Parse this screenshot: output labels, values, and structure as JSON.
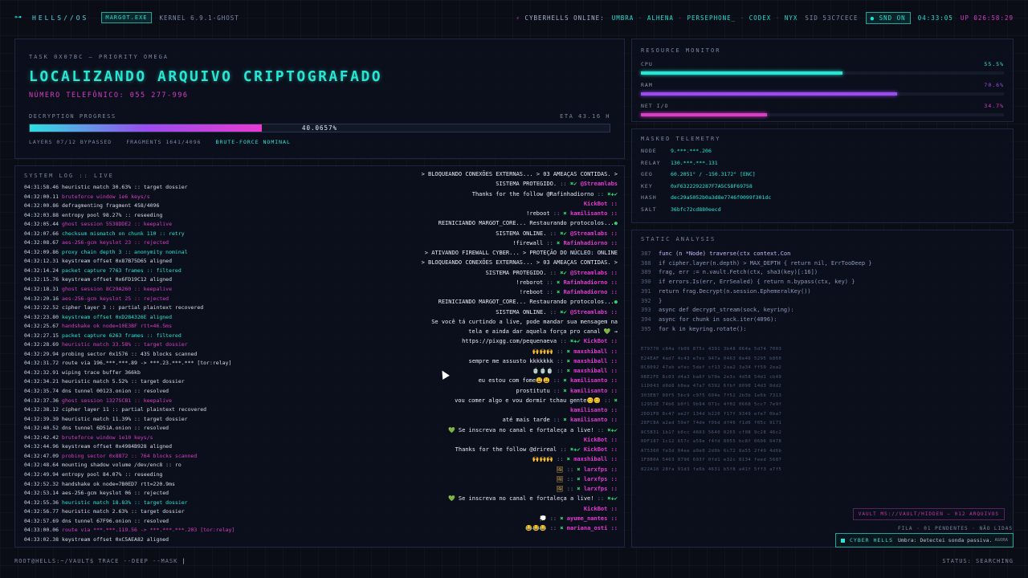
{
  "topbar": {
    "brand": "HELLS//OS",
    "exe": "MARGOT.EXE",
    "kernel": "KERNEL 6.9.1-GHOST",
    "online_label": "CYBERHELLS ONLINE:",
    "users": [
      "UMBRA",
      "ALHENA",
      "PERSEPHONE_",
      "CODEX",
      "NYX"
    ],
    "sid": "SID 53C7CECE",
    "snd": "SND ON",
    "time": "04:33:05",
    "uptime": "UP 026:58:29"
  },
  "task": {
    "id": "TASK 0X07BC — PRIORITY OMEGA",
    "headline": "LOCALIZANDO ARQUIVO CRIPTOGRAFADO",
    "phone": "NÚMERO TELEFÔNICO: 055 277-996",
    "progress_label": "DECRYPTION PROGRESS",
    "eta": "ETA 43.16 H",
    "progress": 0.400657,
    "progress_text": "40.0657%",
    "layers": "LAYERS 07/12 BYPASSED",
    "fragments": "FRAGMENTS 1641/4096",
    "mode": "BRUTE-FORCE NOMINAL"
  },
  "syslog": {
    "title": "SYSTEM LOG :: LIVE",
    "lines": [
      {
        "ts": "04:31:58.46",
        "text": "heuristic match 30.63% :: target dossier",
        "c": "white"
      },
      {
        "ts": "04:32:00.11",
        "text": "bruteforce window 1e6 keys/s",
        "c": "mag"
      },
      {
        "ts": "04:32:00.86",
        "text": "defragmenting fragment 458/4096",
        "c": "white"
      },
      {
        "ts": "04:32:03.88",
        "text": "entropy pool 98.27% :: reseeding",
        "c": "white"
      },
      {
        "ts": "04:32:05.44",
        "text": "ghost session 5538DDE2 :: keepalive",
        "c": "mag"
      },
      {
        "ts": "04:32:07.66",
        "text": "checksum mismatch on chunk 110 :: retry",
        "c": "cyan"
      },
      {
        "ts": "04:32:08.67",
        "text": "aes-256-gcm keyslot 23 :: rejected",
        "c": "mag"
      },
      {
        "ts": "04:32:09.86",
        "text": "proxy chain depth 3 :: anonymity nominal",
        "c": "cyan"
      },
      {
        "ts": "04:32:12.31",
        "text": "keystream offset 0x87B75D65 aligned",
        "c": "white"
      },
      {
        "ts": "04:32:14.24",
        "text": "packet capture 7763 frames :: filtered",
        "c": "cyan"
      },
      {
        "ts": "04:32:15.76",
        "text": "keystream offset 0x6FD19C12 aligned",
        "c": "white"
      },
      {
        "ts": "04:32:18.31",
        "text": "ghost session 8C29A260 :: keepalive",
        "c": "mag"
      },
      {
        "ts": "04:32:20.16",
        "text": "aes-256-gcm keyslot 25 :: rejected",
        "c": "mag"
      },
      {
        "ts": "04:32:22.52",
        "text": "cipher layer 3 :: partial plaintext recovered",
        "c": "white"
      },
      {
        "ts": "04:32:23.80",
        "text": "keystream offset 0xD284326E aligned",
        "c": "cyan"
      },
      {
        "ts": "04:32:25.67",
        "text": "handshake ok node=10E3BF rtt=46.5ms",
        "c": "mag"
      },
      {
        "ts": "04:32:27.15",
        "text": "packet capture 6263 frames :: filtered",
        "c": "cyan"
      },
      {
        "ts": "04:32:28.69",
        "text": "heuristic match 33.58% :: target dossier",
        "c": "mag"
      },
      {
        "ts": "04:32:29.94",
        "text": "probing sector 0x1576 :: 435 blocks scanned",
        "c": "white"
      },
      {
        "ts": "04:32:31.72",
        "text": "route via 196.***.***.89 -> ***.23.***.*** [tor:relay]",
        "c": "white"
      },
      {
        "ts": "04:32:32.91",
        "text": "wiping trace buffer 366kb",
        "c": "white"
      },
      {
        "ts": "04:32:34.21",
        "text": "heuristic match 5.52% :: target dossier",
        "c": "white"
      },
      {
        "ts": "04:32:35.74",
        "text": "dns tunnel 00123.onion :: resolved",
        "c": "white"
      },
      {
        "ts": "04:32:37.36",
        "text": "ghost session 1327SCB1 :: keepalive",
        "c": "mag"
      },
      {
        "ts": "04:32:38.12",
        "text": "cipher layer 11 :: partial plaintext recovered",
        "c": "white"
      },
      {
        "ts": "04:32:39.39",
        "text": "heuristic match 11.39% :: target dossier",
        "c": "white"
      },
      {
        "ts": "04:32:40.52",
        "text": "dns tunnel 6D51A.onion :: resolved",
        "c": "white"
      },
      {
        "ts": "04:32:42.42",
        "text": "bruteforce window 1e10 keys/s",
        "c": "mag"
      },
      {
        "ts": "04:32:44.96",
        "text": "keystream offset 0x4984B928 aligned",
        "c": "white"
      },
      {
        "ts": "04:32:47.09",
        "text": "probing sector 0x8872 :: 764 blocks scanned",
        "c": "mag"
      },
      {
        "ts": "04:32:48.64",
        "text": "mounting shadow volume /dev/enc8 :: ro",
        "c": "white"
      },
      {
        "ts": "04:32:49.94",
        "text": "entropy pool 84.07% :: reseeding",
        "c": "white"
      },
      {
        "ts": "04:32:52.32",
        "text": "handshake ok node=7B0ED7 rtt=220.9ms",
        "c": "white"
      },
      {
        "ts": "04:32:53.14",
        "text": "aes-256-gcm keyslot 06 :: rejected",
        "c": "white"
      },
      {
        "ts": "04:32:55.36",
        "text": "heuristic match 18.83% :: target dossier",
        "c": "cyan"
      },
      {
        "ts": "04:32:56.77",
        "text": "heuristic match 2.63% :: target dossier",
        "c": "white"
      },
      {
        "ts": "04:32:57.69",
        "text": "dns tunnel 67F96.onion :: resolved",
        "c": "white"
      },
      {
        "ts": "04:33:00.06",
        "text": "route via ***.***.119.56 -> ***.***.***.203 [tor:relay]",
        "c": "mag"
      },
      {
        "ts": "04:33:02.38",
        "text": "keystream offset 0xC5AEA82 aligned",
        "c": "white"
      }
    ]
  },
  "chat": [
    {
      "msg": "> BLOQUEANDO CONEXÕES EXTERNAS... > 03 AMEAÇAS CONTIDAS. >",
      "faded": true
    },
    {
      "msg": "SISTEMA PROTEGIDO.",
      "sep": "::",
      "badge": "✖✔",
      "author": "@Streamlabs",
      "faded": true
    },
    {
      "msg": "Thanks for the follow @Rafinhadiorno",
      "sep": "::",
      "badge": "✖✚✔",
      "author": ""
    },
    {
      "msg": "",
      "sep": "",
      "badge": "",
      "author": "KickBot ::"
    },
    {
      "msg": "!reboot",
      "sep": "::",
      "badge": "✖",
      "author": "kamilisanto ::"
    },
    {
      "msg": "REINICIANDO MARGOT_CORE... Restaurando protocolos...",
      "sep": "",
      "badge": "●",
      "author": ""
    },
    {
      "msg": "SISTEMA ONLINE.",
      "sep": "::",
      "badge": "✖✔",
      "author": "@Streamlabs ::"
    },
    {
      "msg": "!firewall",
      "sep": "::",
      "badge": "✖",
      "author": "Rafinhadiorno ::"
    },
    {
      "msg": "> ATIVANDO FIREWALL CYBER... > PROTEÇÃO DO NÚCLEO: ONLINE",
      "sep": "",
      "badge": "",
      "author": ""
    },
    {
      "msg": "> BLOQUEANDO CONEXÕES EXTERNAS... > 03 AMEAÇAS CONTIDAS. >",
      "sep": "",
      "badge": "",
      "author": ""
    },
    {
      "msg": "SISTEMA PROTEGIDO.",
      "sep": "::",
      "badge": "✖✔",
      "author": "@Streamlabs ::"
    },
    {
      "msg": "!reborot",
      "sep": "::",
      "badge": "✖",
      "author": "Rafinhadiorno ::"
    },
    {
      "msg": "!reboot",
      "sep": "::",
      "badge": "✖",
      "author": "Rafinhadiorno ::"
    },
    {
      "msg": "REINICIANDO MARGOT_CORE... Restaurando protocolos...",
      "sep": "",
      "badge": "●",
      "author": ""
    },
    {
      "msg": "SISTEMA ONLINE.",
      "sep": "::",
      "badge": "✖✔",
      "author": "@Streamlabs ::"
    },
    {
      "msg": "Se você tá curtindo a live, pode mandar sua mensagem na",
      "sep": "",
      "badge": "",
      "author": ""
    },
    {
      "msg": "tela e ainda dar aquela força pro canal 💚 →",
      "sep": "",
      "badge": "",
      "author": ""
    },
    {
      "msg": "https://pixgg.com/pequenaeva",
      "sep": "::",
      "badge": "✖✚✔",
      "author": "KickBot ::"
    },
    {
      "msg": "",
      "emo": "🙌🙌🙌",
      "sep": "::",
      "badge": "✖",
      "author": "maxshiball ::"
    },
    {
      "msg": "sempre me assusto kkkkkkk",
      "sep": "::",
      "badge": "✖",
      "author": "maxshiball ::"
    },
    {
      "msg": "",
      "emo": "🍵🍵🍵",
      "sep": "::",
      "badge": "✖",
      "author": "maxshiball ::"
    },
    {
      "msg": "eu estou com fome",
      "emo": "😩😩",
      "sep": "::",
      "badge": "✖",
      "author": "kamilisanto ::"
    },
    {
      "msg": "prostitutu",
      "sep": "::",
      "badge": "✖",
      "author": "kamilisanto ::"
    },
    {
      "msg": "vou comer algo e vou dormir tchau gente",
      "emo": "😊😊",
      "sep": "::",
      "badge": "✖",
      "author": ""
    },
    {
      "msg": "",
      "sep": "",
      "badge": "",
      "author": "kamilisanto ::"
    },
    {
      "msg": "até mais tarde",
      "sep": "::",
      "badge": "✖",
      "author": "kamilisanto ::"
    },
    {
      "msg": "💚 Se inscreva no canal e fortaleça a live!",
      "sep": "::",
      "badge": "✖✚✔",
      "author": ""
    },
    {
      "msg": "",
      "sep": "",
      "badge": "",
      "author": "KickBot ::"
    },
    {
      "msg": "Thanks for the follow @drireal",
      "sep": "::",
      "badge": "✖✚✔",
      "author": "KickBot ::"
    },
    {
      "msg": "",
      "emo": "🙌🙌🙌",
      "sep": "::",
      "badge": "✖",
      "author": "maxshiball ::"
    },
    {
      "msg": "",
      "emo": "🖼",
      "sep": "::",
      "badge": "✖",
      "author": "larxfps ::"
    },
    {
      "msg": "",
      "emo": "🖼",
      "sep": "::",
      "badge": "✖",
      "author": "larxfps ::"
    },
    {
      "msg": "",
      "emo": "🖼",
      "sep": "::",
      "badge": "✖",
      "author": "larxfps ::"
    },
    {
      "msg": "💚 Se inscreva no canal e fortaleça a live!",
      "sep": "::",
      "badge": "✖✚✔",
      "author": ""
    },
    {
      "msg": "",
      "sep": "",
      "badge": "",
      "author": "KickBot ::"
    },
    {
      "msg": "",
      "emo": "💭",
      "sep": "::",
      "badge": "✖",
      "author": "ayume_nantes ::"
    },
    {
      "msg": "",
      "emo": "😂😂😂",
      "sep": "::",
      "badge": "✖",
      "author": "mariana_osti ::"
    }
  ],
  "resources": {
    "title": "RESOURCE MONITOR",
    "items": [
      {
        "label": "CPU",
        "value": 0.555,
        "text": "55.5%",
        "color": "#28e6d4"
      },
      {
        "label": "RAM",
        "value": 0.706,
        "text": "70.6%",
        "color": "#9a4cf0"
      },
      {
        "label": "NET I/O",
        "value": 0.347,
        "text": "34.7%",
        "color": "#d93cc7"
      }
    ]
  },
  "telemetry": {
    "title": "MASKED TELEMETRY",
    "rows": [
      {
        "k": "NODE",
        "v": "9.***.***.206"
      },
      {
        "k": "RELAY",
        "v": "130.***.***.131"
      },
      {
        "k": "GEO",
        "v": "60.2051° / -150.3172° [ENC]"
      },
      {
        "k": "KEY",
        "v": "0xF6322292287F7A5C58F69758"
      },
      {
        "k": "HASH",
        "v": "dec29a5052b0a3d8e7746f0099f301dc"
      },
      {
        "k": "SALT",
        "v": "36bfc72cd880eecd"
      }
    ]
  },
  "static": {
    "title": "STATIC ANALYSIS",
    "code": [
      {
        "ln": "387",
        "src": "func (n *Node) traverse(ctx context.Con",
        "active": true
      },
      {
        "ln": "388",
        "src": "if cipher.layer(n.depth) > MAX_DEPTH { return nil, ErrTooDeep }"
      },
      {
        "ln": "389",
        "src": "frag, err := n.vault.Fetch(ctx, sha3(key)[:16])"
      },
      {
        "ln": "390",
        "src": "if errors.Is(err, ErrSealed) { return n.bypass(ctx, key) }"
      },
      {
        "ln": "391",
        "src": "return frag.Decrypt(n.session.EphemeralKey())"
      },
      {
        "ln": "392",
        "src": "}"
      },
      {
        "ln": "393",
        "src": "async def decrypt_stream(sock, keyring):"
      },
      {
        "ln": "394",
        "src": "async for chunk in sock.iter(4096):"
      },
      {
        "ln": "395",
        "src": "for k in keyring.rotate():"
      }
    ],
    "hex": [
      "E79770 c04a fb09 875c 4391 3b48 064a 5d74 7003",
      "E24EAF 4ad7 4c43 e7ec 947a 0463 8e46 5295 b860",
      "8C8092 47ab afec 5def cf13 2aa2 3a34 ff59 2ea2",
      "0BE2FE 8c03 d4a3 ba6f b70e 2e3c 4d58 54d1 cb49",
      "11D043 d0d8 b0ea 47a7 6392 6fbf 8090 14d3 0dd2",
      "303EB7 80f5 5bc9 c975 604e 7f52 2b3b 1e6b 7313",
      "12952E 74b6 b0f1 9b94 071c 4f02 0668 5cc7 7e9f",
      "2DD1F8 8c47 ae2f 134d b220 f17f 9349 efe7 0ba7",
      "28FC8A a2ad 59ef 74de f0bd df46 f1d6 f05c 9171",
      "8C5B31 1b17 b0cc 4603 5640 0265 cf08 9c28 46c2",
      "0DF187 1c12 657c a59e f4fd 8055 bc8f 0606 0478",
      "A75360 fe3d 04ee a0e0 2d0b 6c72 8a55 2f49 4d6b",
      "1F8B0A 5463 8796 693f 0fd1 e32c 8134 feed 5687",
      "822A16 28fa 91d3 fe6b 4631 b5f8 a41f 5ff3 a7f5"
    ],
    "vault": "VAULT MS://VAULT/HIDDEN — 012 ARQUIVOS",
    "fila": "FILA · 01 PENDENTES · NÃO LIDAS"
  },
  "notification": {
    "name": "CYBER HELLS",
    "text": "Umbra: Detectei sonda passiva.",
    "now": "AGORA"
  },
  "prompt": {
    "text": "ROOT@HELLS:~/VAULT$ TRACE --DEEP --MASK",
    "caret": "|"
  },
  "status": "STATUS: SEARCHING"
}
